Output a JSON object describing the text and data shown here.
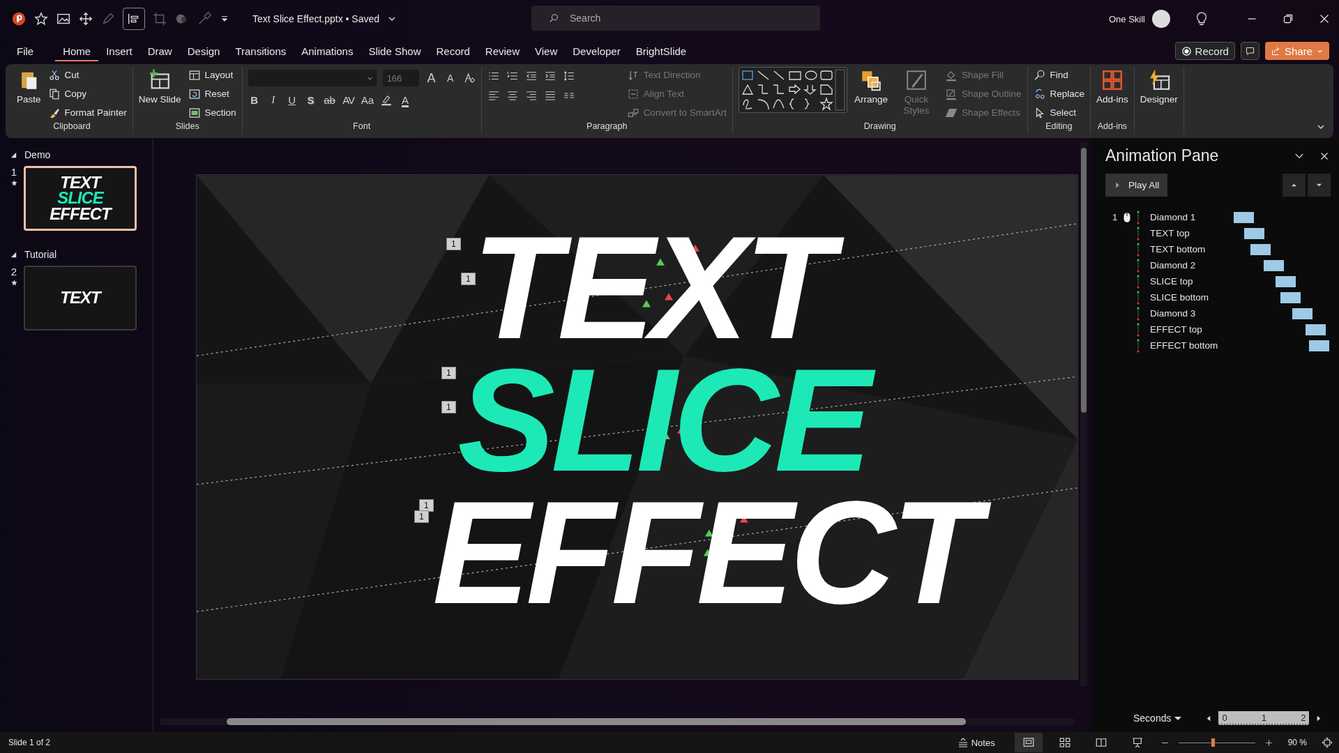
{
  "title_bar": {
    "file_title": "Text Slice Effect.pptx • Saved",
    "search_placeholder": "Search",
    "user": "One Skill"
  },
  "menu_tabs": [
    {
      "label": "File",
      "selected": false
    },
    {
      "label": "Home",
      "selected": true
    },
    {
      "label": "Insert",
      "selected": false
    },
    {
      "label": "Draw",
      "selected": false
    },
    {
      "label": "Design",
      "selected": false
    },
    {
      "label": "Transitions",
      "selected": false
    },
    {
      "label": "Animations",
      "selected": false
    },
    {
      "label": "Slide Show",
      "selected": false
    },
    {
      "label": "Record",
      "selected": false
    },
    {
      "label": "Review",
      "selected": false
    },
    {
      "label": "View",
      "selected": false
    },
    {
      "label": "Developer",
      "selected": false
    },
    {
      "label": "BrightSlide",
      "selected": false
    }
  ],
  "header_buttons": [
    {
      "label": "Record",
      "kind": "record"
    },
    {
      "label": "Share",
      "kind": "share"
    }
  ],
  "ribbon": {
    "groups": [
      {
        "kind": "commands",
        "label": "Clipboard",
        "commands": [
          {
            "label": "Paste",
            "kind": "large",
            "disabled": false
          },
          {
            "label": "Cut",
            "kind": "small",
            "disabled": false
          },
          {
            "label": "Copy",
            "kind": "small",
            "disabled": false
          },
          {
            "label": "Format Painter",
            "kind": "small",
            "disabled": false
          }
        ]
      },
      {
        "kind": "commands",
        "label": "Slides",
        "commands": [
          {
            "label": "New Slide",
            "kind": "large",
            "disabled": false
          },
          {
            "label": "Layout",
            "kind": "small",
            "disabled": false
          },
          {
            "label": "Reset",
            "kind": "small",
            "disabled": false
          },
          {
            "label": "Section",
            "kind": "small",
            "disabled": false
          }
        ]
      },
      {
        "kind": "font",
        "label": "Font",
        "font_size": "166",
        "buttons": [
          {
            "label": "A",
            "kind": "grow"
          },
          {
            "label": "A",
            "kind": "shrink"
          },
          {
            "label": "B",
            "kind": "bold"
          },
          {
            "label": "I",
            "kind": "italic"
          },
          {
            "label": "U",
            "kind": "underline"
          },
          {
            "label": "S",
            "kind": "shadow"
          },
          {
            "label": "ab",
            "kind": "strike"
          },
          {
            "label": "AV",
            "kind": "spacing"
          },
          {
            "label": "Aa",
            "kind": "case"
          },
          {
            "label": "A",
            "kind": "color"
          }
        ]
      },
      {
        "kind": "paragraph",
        "label": "Paragraph",
        "commands": [
          {
            "label": "Text Direction",
            "kind": "small",
            "disabled": true
          },
          {
            "label": "Align Text",
            "kind": "small",
            "disabled": true
          },
          {
            "label": "Convert to SmartArt",
            "kind": "small",
            "disabled": true
          }
        ]
      },
      {
        "kind": "drawing",
        "label": "Drawing",
        "commands": [
          {
            "label": "Arrange",
            "kind": "large",
            "disabled": false
          },
          {
            "label": "Quick Styles",
            "kind": "large",
            "disabled": true
          },
          {
            "label": "Shape Fill",
            "kind": "small",
            "disabled": true
          },
          {
            "label": "Shape Outline",
            "kind": "small",
            "disabled": true
          },
          {
            "label": "Shape Effects",
            "kind": "small",
            "disabled": true
          }
        ]
      },
      {
        "kind": "commands",
        "label": "Editing",
        "commands": [
          {
            "label": "Find",
            "kind": "small",
            "disabled": false
          },
          {
            "label": "Replace",
            "kind": "small",
            "disabled": false
          },
          {
            "label": "Select",
            "kind": "small",
            "disabled": false
          }
        ]
      },
      {
        "kind": "commands",
        "label": "Add-ins",
        "commands": [
          {
            "label": "Add-ins",
            "kind": "large",
            "disabled": false
          }
        ]
      },
      {
        "kind": "commands",
        "commands": [
          {
            "label": "Designer",
            "kind": "large",
            "disabled": false
          }
        ]
      }
    ]
  },
  "sections": [
    {
      "name": "Demo",
      "slides": [
        {
          "number": "1",
          "selected": true,
          "lines": [
            {
              "text": "TEXT",
              "accent": false
            },
            {
              "text": "SLICE",
              "accent": true
            },
            {
              "text": "EFFECT",
              "accent": false
            }
          ]
        }
      ]
    },
    {
      "name": "Tutorial",
      "slides": [
        {
          "number": "2",
          "selected": false,
          "lines": [
            {
              "text": "TEXT",
              "accent": false
            }
          ]
        }
      ]
    }
  ],
  "slide": {
    "lines": [
      {
        "text": "TEXT",
        "accent": false
      },
      {
        "text": "SLICE",
        "accent": true
      },
      {
        "text": "EFFECT",
        "accent": false
      }
    ],
    "animation_tags": [
      "1",
      "1",
      "1",
      "1",
      "1",
      "1"
    ]
  },
  "animation_pane": {
    "title": "Animation Pane",
    "play_all": "Play All",
    "items": [
      {
        "number": "1",
        "name": "Diamond 1"
      },
      {
        "name": "TEXT top"
      },
      {
        "name": "TEXT bottom"
      },
      {
        "name": "Diamond 2"
      },
      {
        "name": "SLICE top"
      },
      {
        "name": "SLICE bottom"
      },
      {
        "name": "Diamond 3"
      },
      {
        "name": "EFFECT top"
      },
      {
        "name": "EFFECT bottom"
      }
    ],
    "timeline": {
      "unit": "Seconds",
      "ticks": [
        "0",
        "1",
        "2"
      ]
    }
  },
  "status_bar": {
    "slide_info": "Slide 1 of 2",
    "notes": "Notes",
    "zoom": "90 %",
    "zoom_slider": {
      "level": 0.45
    }
  }
}
